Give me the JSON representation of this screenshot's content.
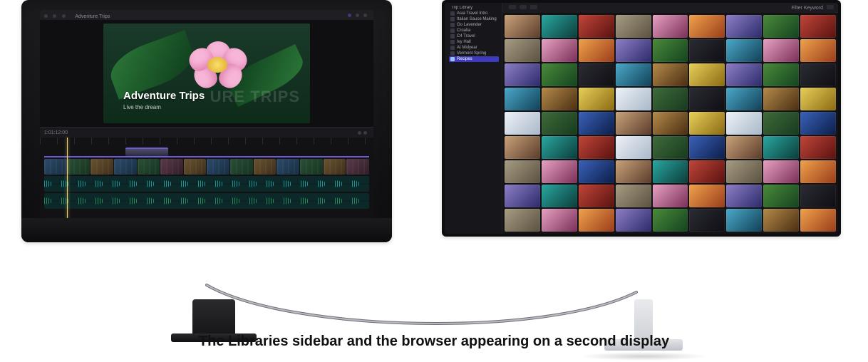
{
  "caption": "The Libraries sidebar and the browser appearing on a second display",
  "viewer": {
    "title_overlay": "Adventure Trips",
    "subtitle_overlay": "Live the dream",
    "ghost_title": "URE TRIPS",
    "header_label": "Adventure Trips"
  },
  "timeline": {
    "timecode": "1:01:12:00"
  },
  "browser": {
    "search_placeholder": "Filter Keyword",
    "sidebar": {
      "library": "Trip Library",
      "items": [
        {
          "label": "Asia Travel Intro"
        },
        {
          "label": "Italian Sauce Making"
        },
        {
          "label": "Go Lavender"
        },
        {
          "label": "Croatia"
        },
        {
          "label": "C4 Travel"
        },
        {
          "label": "Ivy Hall"
        },
        {
          "label": "At Midyear"
        },
        {
          "label": "Vermont Spring"
        },
        {
          "label": "Recipes",
          "selected": true
        }
      ]
    }
  }
}
